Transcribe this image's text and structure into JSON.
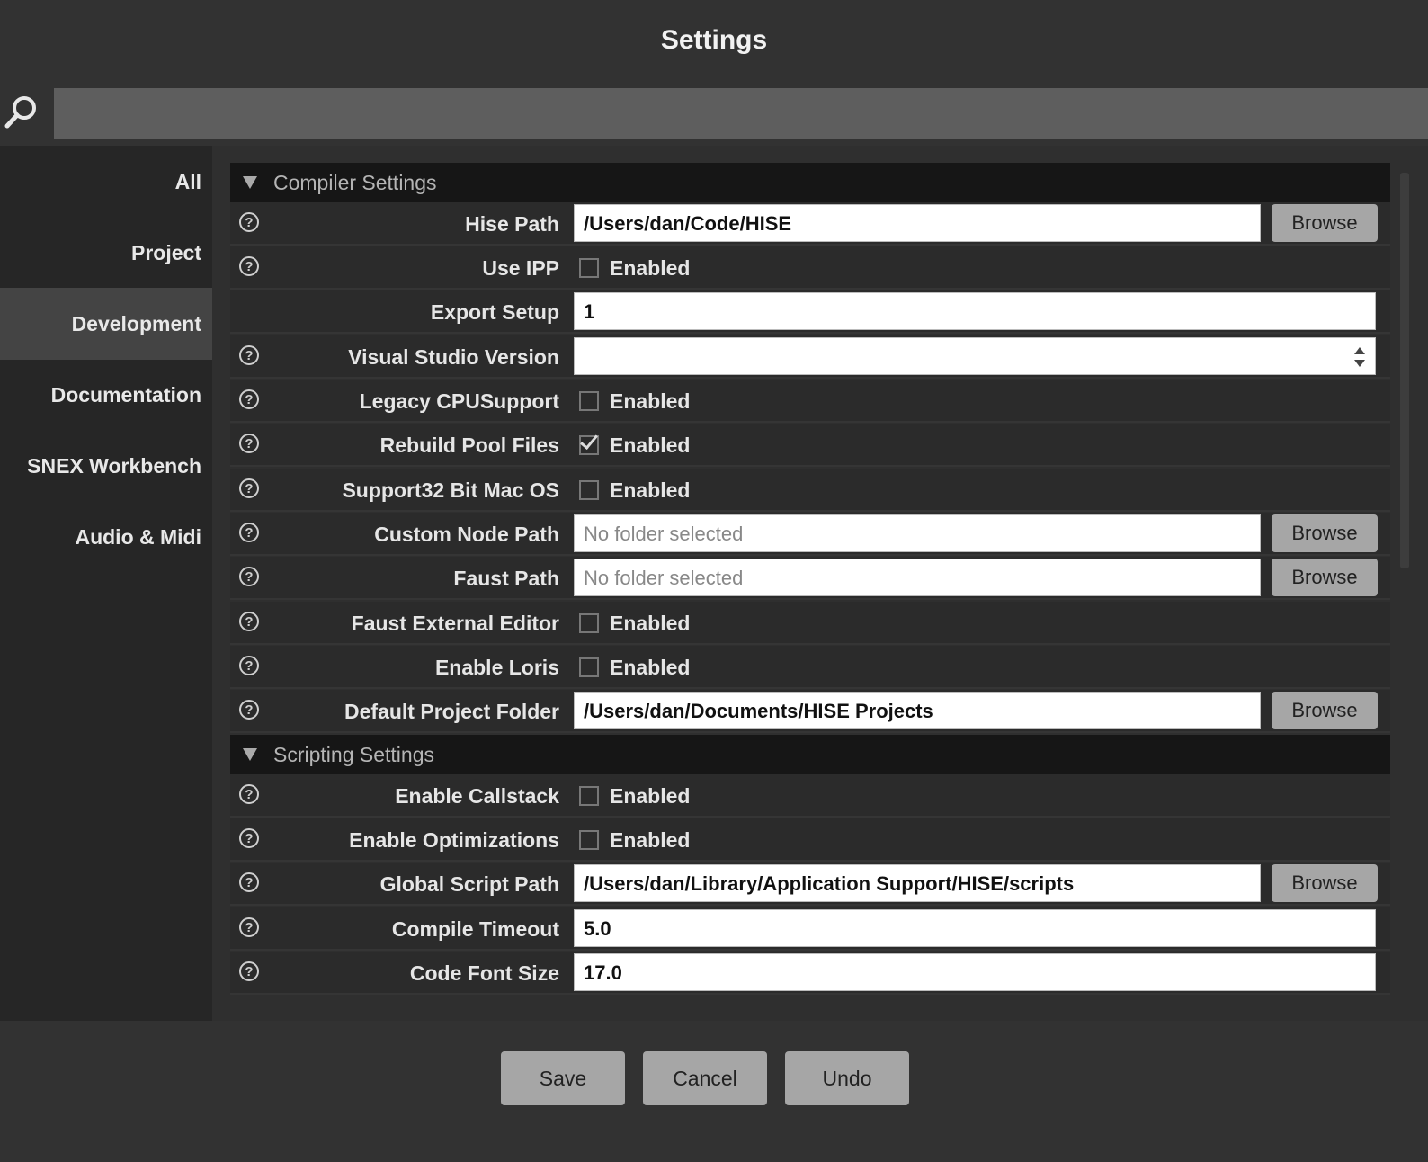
{
  "title": "Settings",
  "search": {
    "value": ""
  },
  "sidebar": {
    "items": [
      {
        "label": "All"
      },
      {
        "label": "Project"
      },
      {
        "label": "Development"
      },
      {
        "label": "Documentation"
      },
      {
        "label": "SNEX Workbench"
      },
      {
        "label": "Audio & Midi"
      }
    ],
    "active": "Development"
  },
  "sections": {
    "compiler": {
      "title": "Compiler Settings",
      "hise_path": {
        "label": "Hise Path",
        "value": "/Users/dan/Code/HISE",
        "button": "Browse"
      },
      "use_ipp": {
        "label": "Use IPP",
        "checkbox_label": "Enabled",
        "checked": false
      },
      "export_setup": {
        "label": "Export Setup",
        "value": "1"
      },
      "visual_studio": {
        "label": "Visual Studio Version",
        "value": ""
      },
      "legacy_cpu": {
        "label": "Legacy CPUSupport",
        "checkbox_label": "Enabled",
        "checked": false
      },
      "rebuild_pool": {
        "label": "Rebuild Pool Files",
        "checkbox_label": "Enabled",
        "checked": true
      },
      "support32": {
        "label": "Support32 Bit Mac OS",
        "checkbox_label": "Enabled",
        "checked": false
      },
      "custom_node_path": {
        "label": "Custom Node Path",
        "placeholder": "No folder selected",
        "button": "Browse"
      },
      "faust_path": {
        "label": "Faust Path",
        "placeholder": "No folder selected",
        "button": "Browse"
      },
      "faust_editor": {
        "label": "Faust External Editor",
        "checkbox_label": "Enabled",
        "checked": false
      },
      "enable_loris": {
        "label": "Enable Loris",
        "checkbox_label": "Enabled",
        "checked": false
      },
      "default_project_folder": {
        "label": "Default Project Folder",
        "value": "/Users/dan/Documents/HISE Projects",
        "button": "Browse"
      }
    },
    "scripting": {
      "title": "Scripting Settings",
      "enable_callstack": {
        "label": "Enable Callstack",
        "checkbox_label": "Enabled",
        "checked": false
      },
      "enable_optimizations": {
        "label": "Enable Optimizations",
        "checkbox_label": "Enabled",
        "checked": false
      },
      "global_script_path": {
        "label": "Global Script Path",
        "value": "/Users/dan/Library/Application Support/HISE/scripts",
        "button": "Browse"
      },
      "compile_timeout": {
        "label": "Compile Timeout",
        "value": "5.0"
      },
      "code_font_size": {
        "label": "Code Font Size",
        "value": "17.0"
      }
    }
  },
  "help_glyph": "?",
  "footer": {
    "save": "Save",
    "cancel": "Cancel",
    "undo": "Undo"
  }
}
